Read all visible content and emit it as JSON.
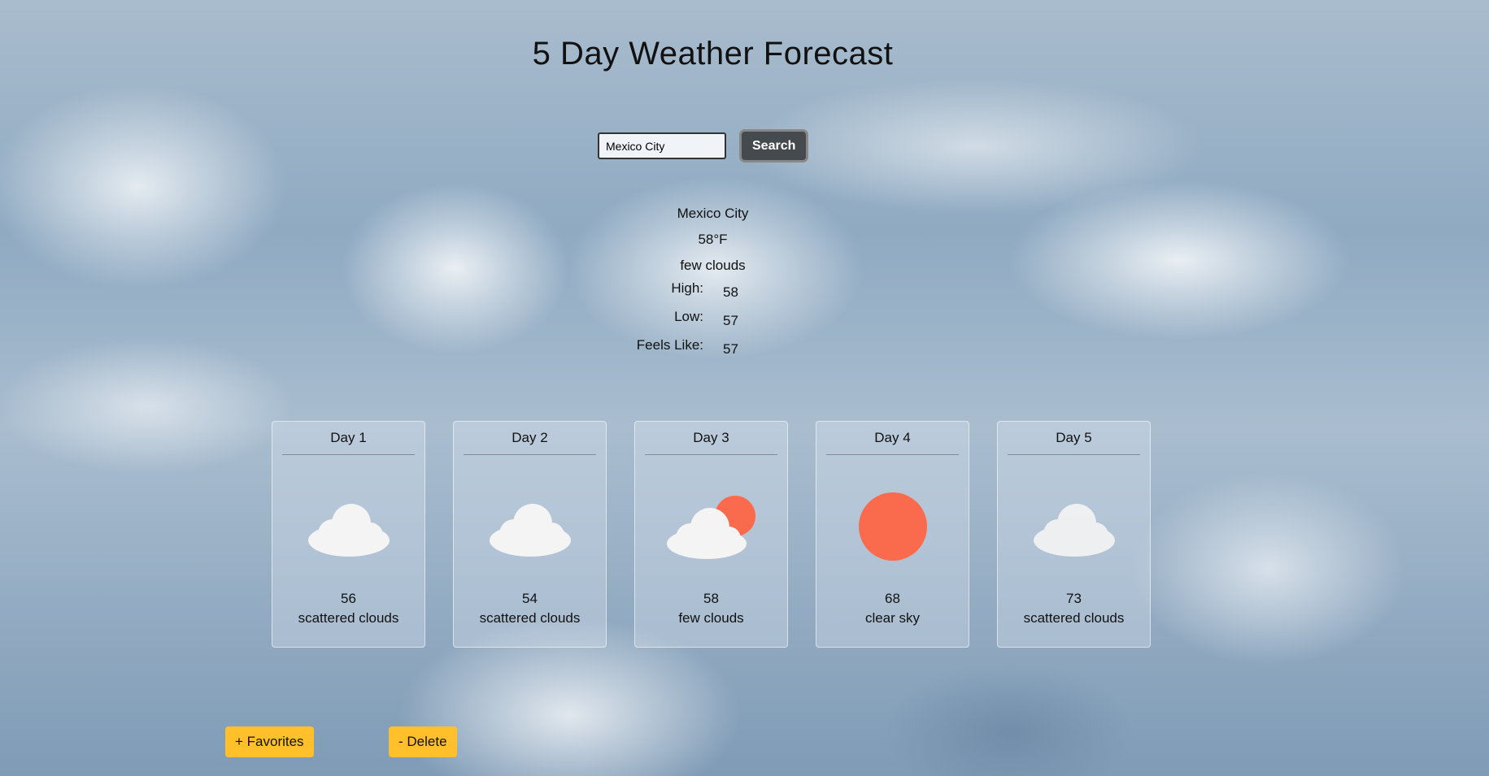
{
  "page": {
    "title": "5 Day Weather Forecast"
  },
  "search": {
    "value": "Mexico City",
    "button_label": "Search"
  },
  "current": {
    "city": "Mexico City",
    "temp": "58°F",
    "description": "few clouds",
    "stats": [
      {
        "label": "High:",
        "value": "58"
      },
      {
        "label": "Low:",
        "value": "57"
      },
      {
        "label": "Feels Like:",
        "value": "57"
      }
    ]
  },
  "forecast": [
    {
      "day": "Day 1",
      "temp": "56",
      "description": "scattered clouds",
      "icon": "cloud-icon"
    },
    {
      "day": "Day 2",
      "temp": "54",
      "description": "scattered clouds",
      "icon": "cloud-icon"
    },
    {
      "day": "Day 3",
      "temp": "58",
      "description": "few clouds",
      "icon": "cloud-sun-icon"
    },
    {
      "day": "Day 4",
      "temp": "68",
      "description": "clear sky",
      "icon": "sun-icon"
    },
    {
      "day": "Day 5",
      "temp": "73",
      "description": "scattered clouds",
      "icon": "cloud-icon"
    }
  ],
  "actions": {
    "favorites_label": "+ Favorites",
    "delete_label": "- Delete"
  },
  "colors": {
    "accent": "#ffc02c",
    "sun": "#fa6a4c",
    "search_button": "#454a4f"
  }
}
